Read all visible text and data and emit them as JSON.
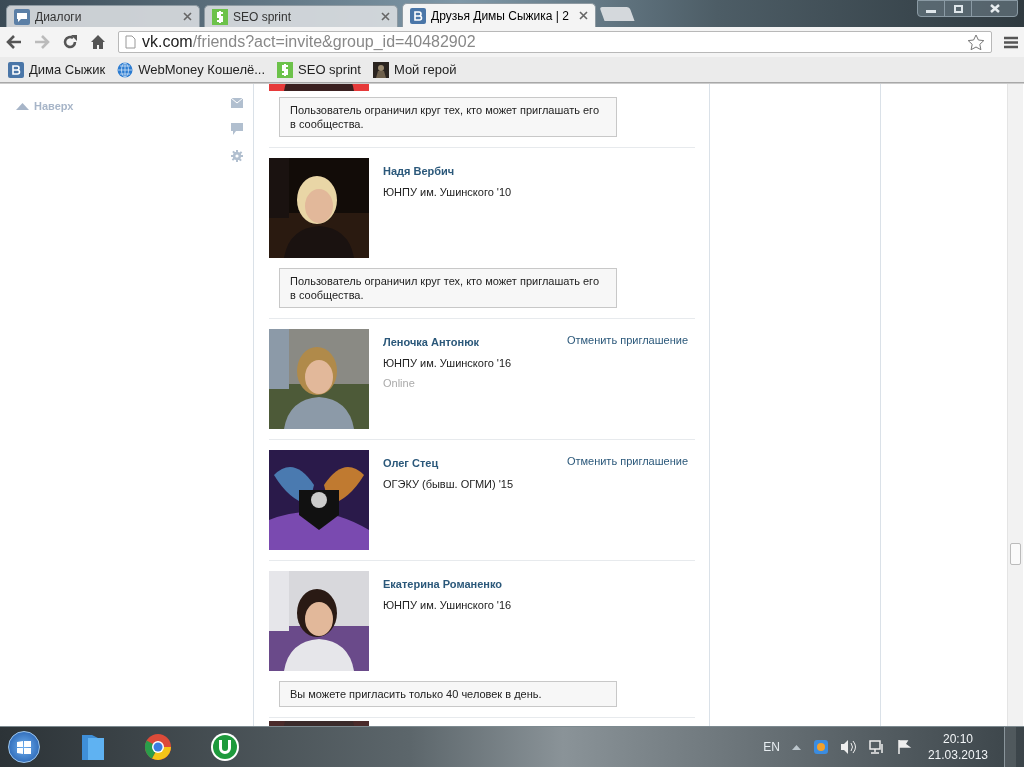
{
  "browser": {
    "tabs": [
      {
        "title": "Диалоги",
        "kind": "chat",
        "selected": false
      },
      {
        "title": "SEO sprint",
        "kind": "seo",
        "selected": false
      },
      {
        "title": "Друзья Димы Сыжика | 2",
        "kind": "vk",
        "selected": true
      }
    ],
    "address": {
      "host": "vk.com",
      "path": "/friends?act=invite&group_id=40482902"
    },
    "bookmarks": [
      {
        "label": "Дима Сыжик",
        "kind": "vk"
      },
      {
        "label": "WebMoney Кошелё...",
        "kind": "globe"
      },
      {
        "label": "SEO sprint",
        "kind": "seo"
      },
      {
        "label": "Мой герой",
        "kind": "hero"
      }
    ]
  },
  "sidebar": {
    "back_to_top": "Наверх"
  },
  "friends": [
    {
      "kind": "partial",
      "notice": "Пользователь ограничил круг тех, кто может приглашать его в сообщества."
    },
    {
      "kind": "full",
      "name": "Надя Вербич",
      "university": "ЮНПУ им. Ушинского '10",
      "notice": "Пользователь ограничил круг тех, кто может приглашать его в сообщества."
    },
    {
      "kind": "full",
      "name": "Леночка Антонюк",
      "university": "ЮНПУ им. Ушинского '16",
      "status": "Online",
      "action": "Отменить приглашение"
    },
    {
      "kind": "full",
      "name": "Олег Стец",
      "university": "ОГЭКУ (бывш. ОГМИ) '15",
      "action": "Отменить приглашение"
    },
    {
      "kind": "full",
      "name": "Екатерина Романенко",
      "university": "ЮНПУ им. Ушинского '16",
      "notice": "Вы можете пригласить только 40 человек в день."
    },
    {
      "kind": "partial"
    }
  ],
  "taskbar": {
    "language": "EN",
    "time": "20:10",
    "date": "21.03.2013"
  }
}
